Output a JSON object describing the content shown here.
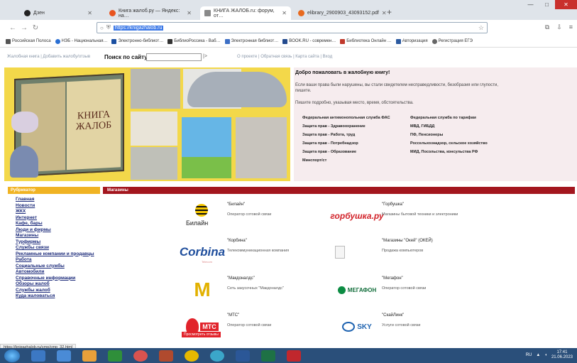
{
  "browser": {
    "tabs": [
      {
        "title": "Дзен",
        "active": false
      },
      {
        "title": "Книга жалоб.ру — Яндекс: на…",
        "active": false
      },
      {
        "title": "КНИГА ЖАЛОБ.ru: форум, от…",
        "active": true
      },
      {
        "title": "elibrary_2900903_43093152.pdf",
        "active": false
      }
    ],
    "new_tab": "+",
    "controls": {
      "minimize": "—",
      "maximize": "□",
      "close": "✕"
    },
    "url": "https://knigazhalob.ru",
    "bookmarks": [
      "Российская Полоса",
      "НЭБ - Национальная…",
      "Электронно-библиот…",
      "БиблиоРоссика - Ваб…",
      "Электронная библиот…",
      "BOOK.RU - современ…",
      "Библиотека Онлайн …",
      "Авторизация",
      "Регистрация ЕГЭ"
    ]
  },
  "page": {
    "top_left_links": "Жалобная книга | Добавить жалобу/отзыв",
    "search_label": "Поиск по сайту",
    "search_value": "",
    "search_go": "|>",
    "top_links": "О проекте | Обратная связь | Карта сайта | Вход",
    "banner": {
      "book_title": "КНИГА ЖАЛОБ"
    },
    "welcome": {
      "title": "Добро пожаловать в жалобную книгу!",
      "p1": "Если ваши права были нарушены, вы стали свидетелем несправедливости, безобразия или глупости, пишите.",
      "p2": "Пишите подробно, указывая место, время, обстоятельства.",
      "orgs": [
        "Федеральная антимонопольная служба ФАС",
        "Федеральная служба по тарифам",
        "Защита прав - Здравоохранение",
        "МВД, ГИБДД",
        "Защита прав - Работа, труд",
        "ПФ, Пенсионеры",
        "Защита прав - Потребнадзор",
        "Россельхознадзор, сельское хозяйство",
        "Защита прав - Образование",
        "МИД, Посольства, консульства РФ",
        "Минспорт/ст",
        ""
      ]
    },
    "rubric_header": "Рубрикатор",
    "shops_header": "Магазины",
    "rubric": [
      "Главная",
      "Новости",
      "ЖКХ",
      "Интернет",
      "Кафе, бары",
      "Люди и фирмы",
      "Магазины",
      "Турфирмы",
      "Службы связи",
      "Рекламные компании и продавцы",
      "Работа",
      "Социальные службы",
      "Автомобили",
      "Справочные информации",
      "Обзоры жалоб",
      "Службы жалоб",
      "Куда жаловаться"
    ],
    "shops": [
      {
        "name": "\"Билайн\"",
        "desc": "Оператор сотовой связи",
        "logo_text": "Билайн"
      },
      {
        "name": "\"Горбушка\"",
        "desc": "Магазины бытовой техники и электроники",
        "logo_text": "горбушка.ру"
      },
      {
        "name": "\"Корбина\"",
        "desc": "Телекоммуникационная компания",
        "logo_text": "Corbina",
        "logo_sub": "Telecom"
      },
      {
        "name": "\"Магазины \"Окей\" (ОКЕЙ)",
        "desc": "Продажа компьютеров",
        "logo_text": ""
      },
      {
        "name": "\"Макдоналдс\"",
        "desc": "Сеть закусочных \"Макдоналдс\"",
        "logo_text": "M"
      },
      {
        "name": "\"Мегафон\"",
        "desc": "Оператор сотовой связи",
        "logo_text": "МЕГАФОН"
      },
      {
        "name": "\"МТС\"",
        "desc": "Оператор сотовой связи",
        "logo_text": "МТС",
        "badge": "Просмотреть отзывы"
      },
      {
        "name": "\"СкайЛинк\"",
        "desc": "Услуги сотовой связи",
        "logo_text": "SKY"
      }
    ]
  },
  "status_url": "https://knigazhalob.ru/cmp/cmp_32.html",
  "taskbar": {
    "lang": "RU",
    "time": "17:41",
    "date": "21.06.2023"
  }
}
